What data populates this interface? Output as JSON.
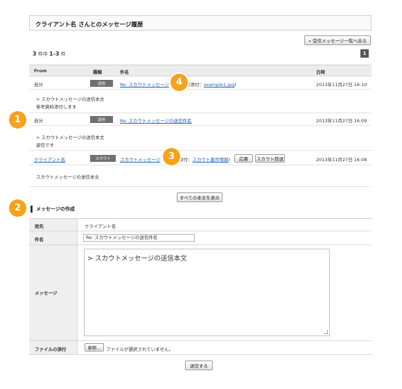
{
  "page": {
    "title": "クライアント名 さんとのメッセージ履歴",
    "back_button": "« 受信メッセージ一覧へ戻る"
  },
  "pagination": {
    "total": "3",
    "total_suffix": " 件中 ",
    "range": "1-3",
    "range_suffix": " 件",
    "current_page": "1"
  },
  "table": {
    "headers": {
      "from": "From",
      "type": "種類",
      "subject": "件名",
      "date": "日時"
    },
    "rows": [
      {
        "from": "自分",
        "type": "返信",
        "subject": "Re: スカウトメッセージ",
        "attach_prefix": "(添付：",
        "attach_file": "example1.jpg",
        "attach_suffix": ")",
        "date": "2013年11月27日 16:10",
        "body_line1": "> スカウトメッセージの送信本文",
        "body_line2": "参考資料添付します"
      },
      {
        "from": "自分",
        "type": "返信",
        "subject": "Re: スカウトメッセージの送信件名",
        "date": "2013年11月27日 16:09",
        "body_line1": "> スカウトメッセージの送信本文",
        "body_line2": "返信です"
      },
      {
        "from": "クライアント名",
        "type": "スカウト",
        "subject": "スカウトメッセージ",
        "attach_prefix": "(添付：",
        "attach_file": "スカウト案件情報",
        "attach_suffix": ")",
        "apply_button": "応募",
        "decline_button": "スカウト辞退",
        "date": "2013年11月27日 16:08",
        "body_line1": "スカウトメッセージの送信本文"
      }
    ]
  },
  "show_all_button": "すべての本文を表示",
  "compose": {
    "section_title": "メッセージの作成",
    "to_label": "宛先",
    "to_value": "クライアント名",
    "subject_label": "件名",
    "subject_value": "Re: スカウトメッセージの送信件名",
    "message_label": "メッセージ",
    "message_value": "> スカウトメッセージの送信本文",
    "attach_label": "ファイルの添付",
    "browse_button": "参照...",
    "no_file_text": "ファイルが選択されていません。",
    "submit_button": "送信する"
  },
  "callouts": [
    "1",
    "2",
    "3",
    "4"
  ],
  "colors": {
    "callout": "#f6a21b",
    "link": "#1a62b0",
    "type_tag": "#707070",
    "header_bg": "#ececec"
  }
}
